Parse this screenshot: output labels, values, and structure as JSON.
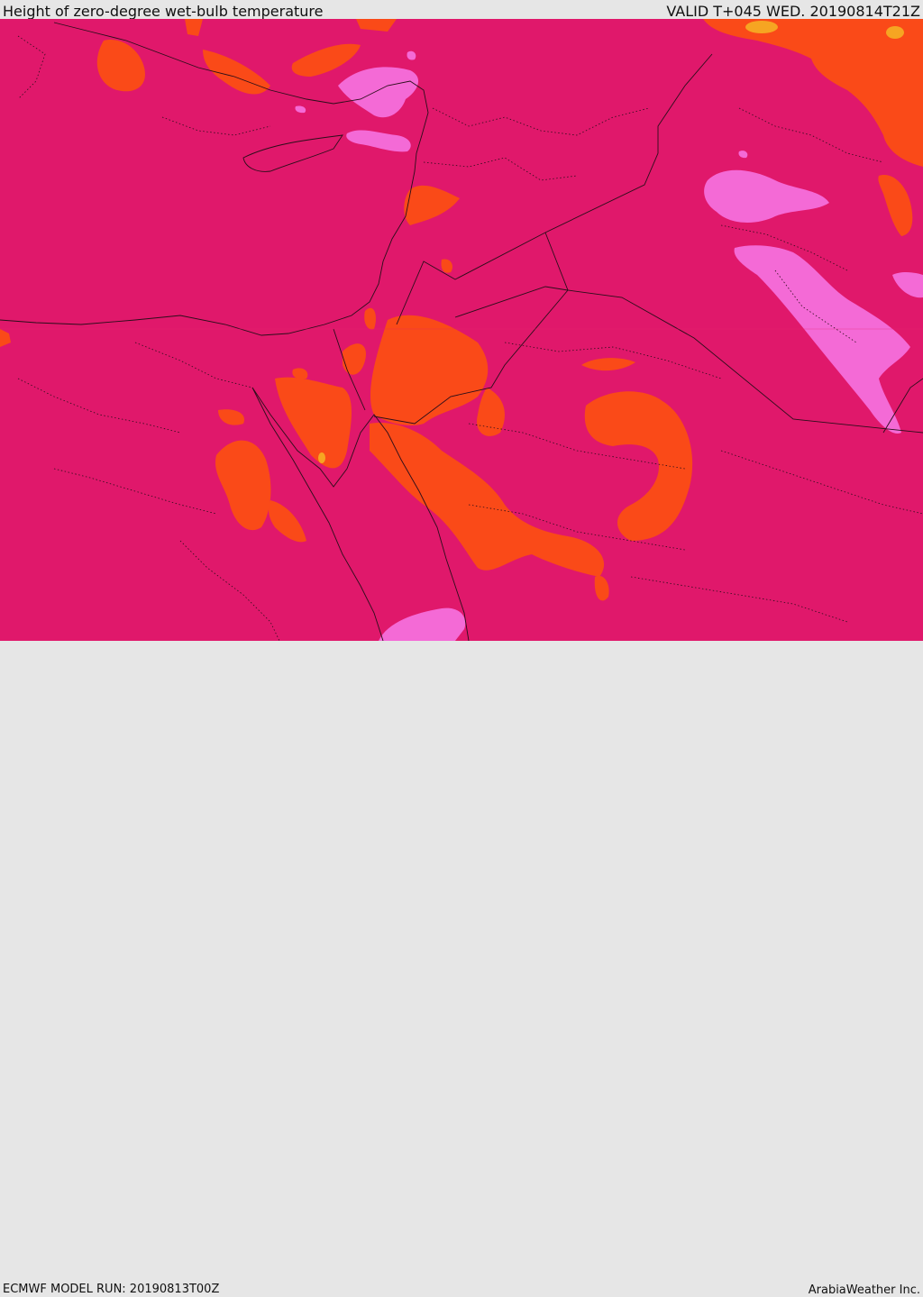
{
  "header": {
    "title": "Height of zero-degree wet-bulb temperature",
    "valid": "VALID T+045 WED. 20190814T21Z"
  },
  "footer": {
    "model_run": "ECMWF MODEL RUN: 20190813T00Z",
    "credit": "ArabiaWeather Inc."
  },
  "map": {
    "colors": {
      "base": "#e0186b",
      "orange": "#fa4a18",
      "pink": "#f46ad6",
      "yellow": "#f6a522",
      "boundary": "#2a0e1a"
    }
  }
}
